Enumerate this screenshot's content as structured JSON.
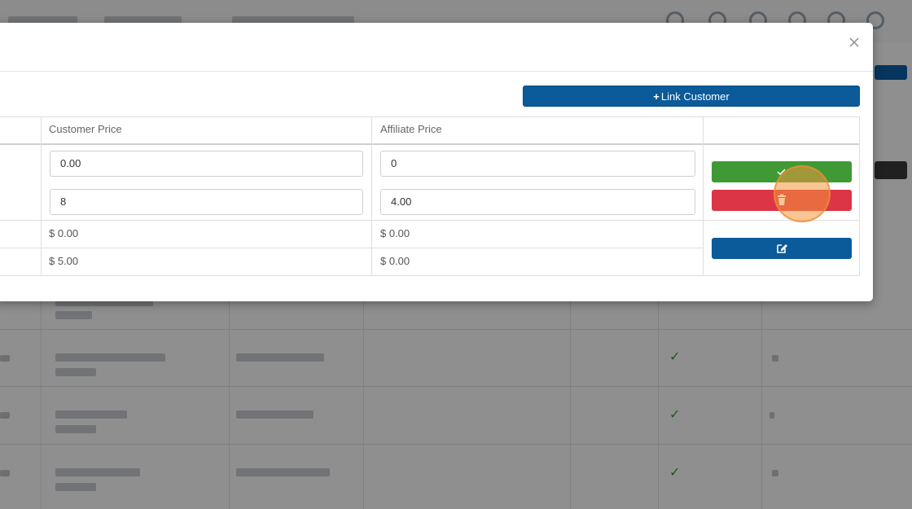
{
  "modal": {
    "close_icon": "close-icon",
    "link_button": {
      "icon": "plus-icon",
      "label": "Link Customer"
    },
    "table": {
      "headers": [
        "Customer Price",
        "Affiliate Price"
      ],
      "rows": [
        {
          "customer_price": "0.00",
          "affiliate_price": "0",
          "editable": true
        },
        {
          "customer_price": "8",
          "affiliate_price": "4.00",
          "editable": true
        },
        {
          "customer_price": "$ 0.00",
          "affiliate_price": "$ 0.00",
          "editable": false
        },
        {
          "customer_price": "$ 5.00",
          "affiliate_price": "$ 0.00",
          "editable": false
        }
      ],
      "actions": {
        "save_icon": "check-icon",
        "delete_icon": "trash-icon",
        "edit_icon": "edit-icon"
      }
    }
  },
  "colors": {
    "primary": "#0b5a9a",
    "success": "#3f9a35",
    "danger": "#dc3545",
    "click_indicator": "#f4963c"
  }
}
